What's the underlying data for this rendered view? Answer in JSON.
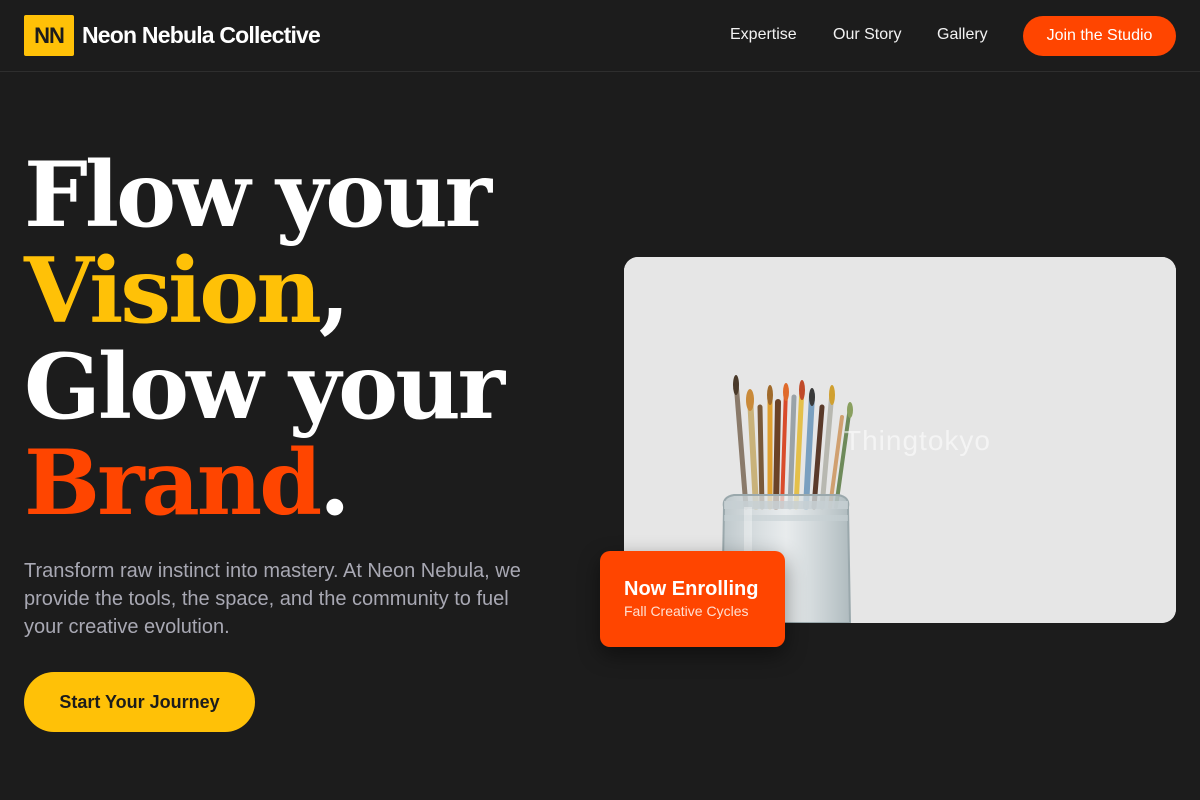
{
  "nav": {
    "logo_mark": "NN",
    "brand_name": "Neon Nebula Collective",
    "links": [
      "Expertise",
      "Our Story",
      "Gallery"
    ],
    "cta": "Join the Studio"
  },
  "hero": {
    "line1": "Flow your",
    "line2_accent": "Vision",
    "line2_punct": ",",
    "line3": "Glow your",
    "line4_accent": "Brand",
    "line4_punct": ".",
    "lead": "Transform raw instinct into mastery. At Neon Nebula, we provide the tools, the space, and the community to fuel your creative evolution.",
    "cta": "Start Your Journey"
  },
  "media": {
    "watermark": "Thingtokyo",
    "icon": "paintbrush-jar-photo"
  },
  "badge": {
    "title": "Now Enrolling",
    "subtitle": "Fall Creative Cycles"
  },
  "colors": {
    "background": "#1c1c1c",
    "accent_yellow": "#ffc107",
    "accent_orange": "#ff4500",
    "muted_text": "#a8a8b3"
  }
}
